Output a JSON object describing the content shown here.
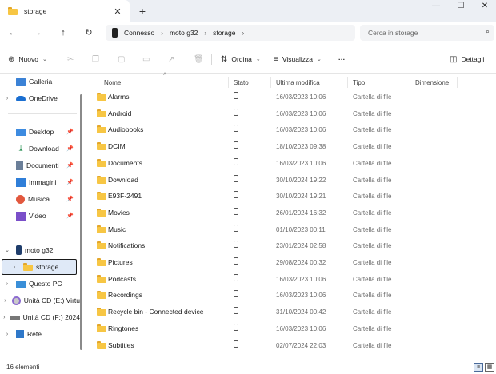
{
  "tab": {
    "title": "storage"
  },
  "window": {
    "minimize": "—",
    "maximize": "☐",
    "close": "✕"
  },
  "address": {
    "segments": [
      "Connesso",
      "moto g32",
      "storage"
    ],
    "search_placeholder": "Cerca in storage"
  },
  "toolbar": {
    "new_label": "Nuovo",
    "sort_label": "Ordina",
    "view_label": "Visualizza",
    "more_label": "···",
    "details_label": "Dettagli"
  },
  "sidebar": {
    "galleria": "Galleria",
    "onedrive": "OneDrive",
    "desktop": "Desktop",
    "download": "Download",
    "documenti": "Documenti",
    "immagini": "Immagini",
    "musica": "Musica",
    "video": "Video",
    "device": "moto g32",
    "storage": "storage",
    "questo_pc": "Questo PC",
    "cd_e": "Unità CD (E:) Virtu",
    "cd_f": "Unità CD (F:) 2024",
    "rete": "Rete"
  },
  "columns": {
    "name": "Nome",
    "status": "Stato",
    "modified": "Ultima modifica",
    "type": "Tipo",
    "size": "Dimensione"
  },
  "files": [
    {
      "name": "Alarms",
      "date": "16/03/2023 10:06",
      "type": "Cartella di file"
    },
    {
      "name": "Android",
      "date": "16/03/2023 10:06",
      "type": "Cartella di file"
    },
    {
      "name": "Audiobooks",
      "date": "16/03/2023 10:06",
      "type": "Cartella di file"
    },
    {
      "name": "DCIM",
      "date": "18/10/2023 09:38",
      "type": "Cartella di file"
    },
    {
      "name": "Documents",
      "date": "16/03/2023 10:06",
      "type": "Cartella di file"
    },
    {
      "name": "Download",
      "date": "30/10/2024 19:22",
      "type": "Cartella di file"
    },
    {
      "name": "E93F-2491",
      "date": "30/10/2024 19:21",
      "type": "Cartella di file"
    },
    {
      "name": "Movies",
      "date": "26/01/2024 16:32",
      "type": "Cartella di file"
    },
    {
      "name": "Music",
      "date": "01/10/2023 00:11",
      "type": "Cartella di file"
    },
    {
      "name": "Notifications",
      "date": "23/01/2024 02:58",
      "type": "Cartella di file"
    },
    {
      "name": "Pictures",
      "date": "29/08/2024 00:32",
      "type": "Cartella di file"
    },
    {
      "name": "Podcasts",
      "date": "16/03/2023 10:06",
      "type": "Cartella di file"
    },
    {
      "name": "Recordings",
      "date": "16/03/2023 10:06",
      "type": "Cartella di file"
    },
    {
      "name": "Recycle bin - Connected device",
      "date": "31/10/2024 00:42",
      "type": "Cartella di file"
    },
    {
      "name": "Ringtones",
      "date": "16/03/2023 10:06",
      "type": "Cartella di file"
    },
    {
      "name": "Subtitles",
      "date": "02/07/2024 22:03",
      "type": "Cartella di file"
    }
  ],
  "statusbar": {
    "count": "16 elementi"
  },
  "colors": {
    "folder": "#f7c644",
    "selection": "#dfe9f7",
    "accent": "#0067c0"
  }
}
